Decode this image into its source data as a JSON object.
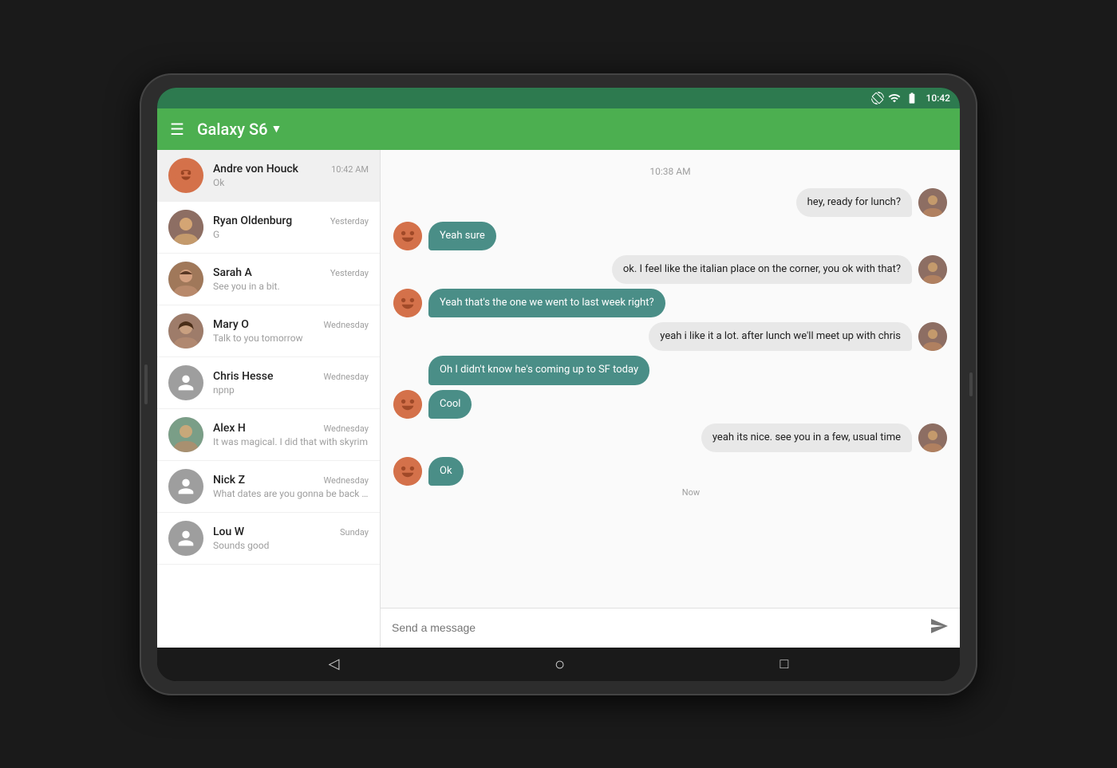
{
  "device": {
    "status_bar": {
      "time": "10:42"
    },
    "app_bar": {
      "menu_icon": "☰",
      "title": "Galaxy S6",
      "dropdown_icon": "▼"
    }
  },
  "contacts": [
    {
      "id": "andre",
      "name": "Andre von Houck",
      "time": "10:42 AM",
      "preview": "Ok",
      "avatar_type": "orange",
      "active": true
    },
    {
      "id": "ryan",
      "name": "Ryan Oldenburg",
      "time": "Yesterday",
      "preview": "G",
      "avatar_type": "photo_ryan"
    },
    {
      "id": "sarah",
      "name": "Sarah A",
      "time": "Yesterday",
      "preview": "See you in a bit.",
      "avatar_type": "photo_sarah"
    },
    {
      "id": "mary",
      "name": "Mary O",
      "time": "Wednesday",
      "preview": "Talk to you tomorrow",
      "avatar_type": "photo_mary"
    },
    {
      "id": "chris",
      "name": "Chris Hesse",
      "time": "Wednesday",
      "preview": "npnp",
      "avatar_type": "generic"
    },
    {
      "id": "alex",
      "name": "Alex H",
      "time": "Wednesday",
      "preview": "It was magical. I did that with skyrim",
      "avatar_type": "photo_alex"
    },
    {
      "id": "nick",
      "name": "Nick Z",
      "time": "Wednesday",
      "preview": "What dates are you gonna be back in M...",
      "avatar_type": "generic"
    },
    {
      "id": "lou",
      "name": "Lou W",
      "time": "Sunday",
      "preview": "Sounds good",
      "avatar_type": "generic"
    }
  ],
  "chat": {
    "timestamp": "10:38 AM",
    "messages": [
      {
        "type": "outgoing",
        "text": "hey, ready for lunch?",
        "show_avatar": true
      },
      {
        "type": "incoming",
        "text": "Yeah sure",
        "show_avatar": true
      },
      {
        "type": "outgoing",
        "text": "ok. I feel like the italian place on the corner, you ok with that?",
        "show_avatar": true
      },
      {
        "type": "incoming",
        "text": "Yeah that's the one we went to last week right?",
        "show_avatar": true
      },
      {
        "type": "outgoing",
        "text": "yeah i like it a lot. after lunch we'll meet up with chris",
        "show_avatar": true
      },
      {
        "type": "incoming",
        "text": "Oh I didn't know he's coming up to SF today",
        "show_avatar": false
      },
      {
        "type": "incoming",
        "text": "Cool",
        "show_avatar": true
      },
      {
        "type": "outgoing",
        "text": "yeah its nice. see you in a few, usual time",
        "show_avatar": true
      },
      {
        "type": "incoming",
        "text": "Ok",
        "show_avatar": true,
        "time_label": "Now"
      }
    ],
    "input_placeholder": "Send a message"
  },
  "nav": {
    "back": "◁",
    "home": "○",
    "recents": "□"
  }
}
